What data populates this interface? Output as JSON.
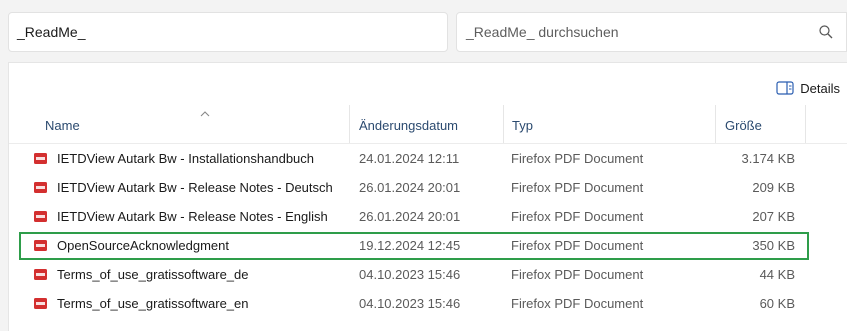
{
  "address_bar": {
    "path": "_ReadMe_"
  },
  "search": {
    "placeholder": "_ReadMe_ durchsuchen"
  },
  "toolbar": {
    "details_label": "Details"
  },
  "columns": {
    "name": "Name",
    "date": "Änderungsdatum",
    "type": "Typ",
    "size": "Größe"
  },
  "files": [
    {
      "name": "IETDView Autark Bw - Installationshandbuch",
      "date": "24.01.2024 12:11",
      "type": "Firefox PDF Document",
      "size": "3.174 KB"
    },
    {
      "name": "IETDView Autark Bw - Release Notes - Deutsch",
      "date": "26.01.2024 20:01",
      "type": "Firefox PDF Document",
      "size": "209 KB"
    },
    {
      "name": "IETDView Autark Bw - Release Notes - English",
      "date": "26.01.2024 20:01",
      "type": "Firefox PDF Document",
      "size": "207 KB"
    },
    {
      "name": "OpenSourceAcknowledgment",
      "date": "19.12.2024 12:45",
      "type": "Firefox PDF Document",
      "size": "350 KB"
    },
    {
      "name": "Terms_of_use_gratissoftware_de",
      "date": "04.10.2023 15:46",
      "type": "Firefox PDF Document",
      "size": "44 KB"
    },
    {
      "name": "Terms_of_use_gratissoftware_en",
      "date": "04.10.2023 15:46",
      "type": "Firefox PDF Document",
      "size": "60 KB"
    }
  ],
  "colors": {
    "highlight": "#2e9d4a",
    "pdf_icon": "#d32f2f",
    "header_text": "#2b4a6f"
  },
  "icons": {
    "file": "pdf-file-icon",
    "search": "search-icon",
    "details": "details-pane-icon"
  }
}
